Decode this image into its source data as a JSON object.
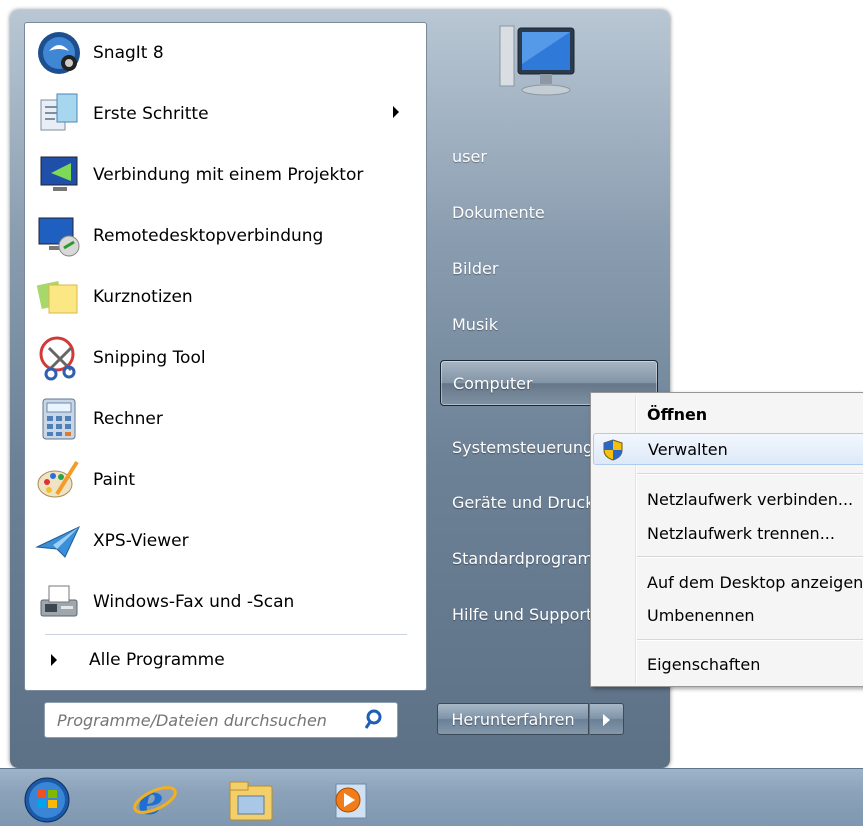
{
  "start_menu": {
    "programs": [
      {
        "label": "SnagIt 8",
        "icon": "snagit-icon",
        "submenu": false
      },
      {
        "label": "Erste Schritte",
        "icon": "getting-started-icon",
        "submenu": true
      },
      {
        "label": "Verbindung mit einem Projektor",
        "icon": "projector-icon",
        "submenu": false
      },
      {
        "label": "Remotedesktopverbindung",
        "icon": "remote-desktop-icon",
        "submenu": false
      },
      {
        "label": "Kurznotizen",
        "icon": "sticky-notes-icon",
        "submenu": false
      },
      {
        "label": "Snipping Tool",
        "icon": "scissors-icon",
        "submenu": false
      },
      {
        "label": "Rechner",
        "icon": "calculator-icon",
        "submenu": false
      },
      {
        "label": "Paint",
        "icon": "paint-palette-icon",
        "submenu": false
      },
      {
        "label": "XPS-Viewer",
        "icon": "xps-viewer-icon",
        "submenu": false
      },
      {
        "label": "Windows-Fax und -Scan",
        "icon": "fax-scanner-icon",
        "submenu": false
      }
    ],
    "all_programs": "Alle Programme",
    "search_placeholder": "Programme/Dateien durchsuchen",
    "right_items": [
      {
        "label": "user"
      },
      {
        "label": "Dokumente"
      },
      {
        "label": "Bilder"
      },
      {
        "label": "Musik"
      },
      {
        "label": "Computer"
      },
      {
        "label": "Systemsteuerung"
      },
      {
        "label": "Geräte und Drucker"
      },
      {
        "label": "Standardprogramme"
      },
      {
        "label": "Hilfe und Support"
      }
    ],
    "shutdown_label": "Herunterfahren"
  },
  "context_menu": {
    "items": [
      {
        "label": "Öffnen",
        "bold": true
      },
      {
        "label": "Verwalten",
        "icon": "uac-shield-icon"
      },
      {
        "label": "Netzlaufwerk verbinden..."
      },
      {
        "label": "Netzlaufwerk trennen..."
      },
      {
        "label": "Auf dem Desktop anzeigen"
      },
      {
        "label": "Umbenennen"
      },
      {
        "label": "Eigenschaften"
      }
    ]
  },
  "taskbar": {
    "items": [
      "start-orb-icon",
      "internet-explorer-icon",
      "explorer-folder-icon",
      "media-player-icon"
    ]
  }
}
